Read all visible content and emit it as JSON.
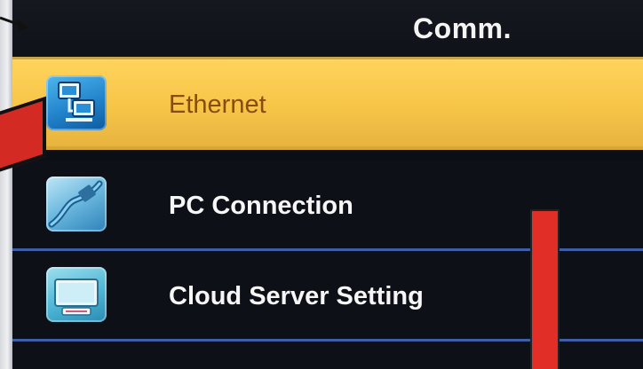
{
  "header": {
    "title": "Comm."
  },
  "menu": {
    "items": [
      {
        "label": "Ethernet",
        "icon": "ethernet-icon",
        "selected": true
      },
      {
        "label": "PC Connection",
        "icon": "pc-connection-icon",
        "selected": false
      },
      {
        "label": "Cloud Server Setting",
        "icon": "cloud-server-icon",
        "selected": false
      }
    ]
  },
  "colors": {
    "selected_bg": "#f6c548",
    "selected_text": "#8a4b10",
    "text": "#f6f6f6",
    "divider": "#3e5fa5",
    "annotation_red": "#d42a24"
  }
}
